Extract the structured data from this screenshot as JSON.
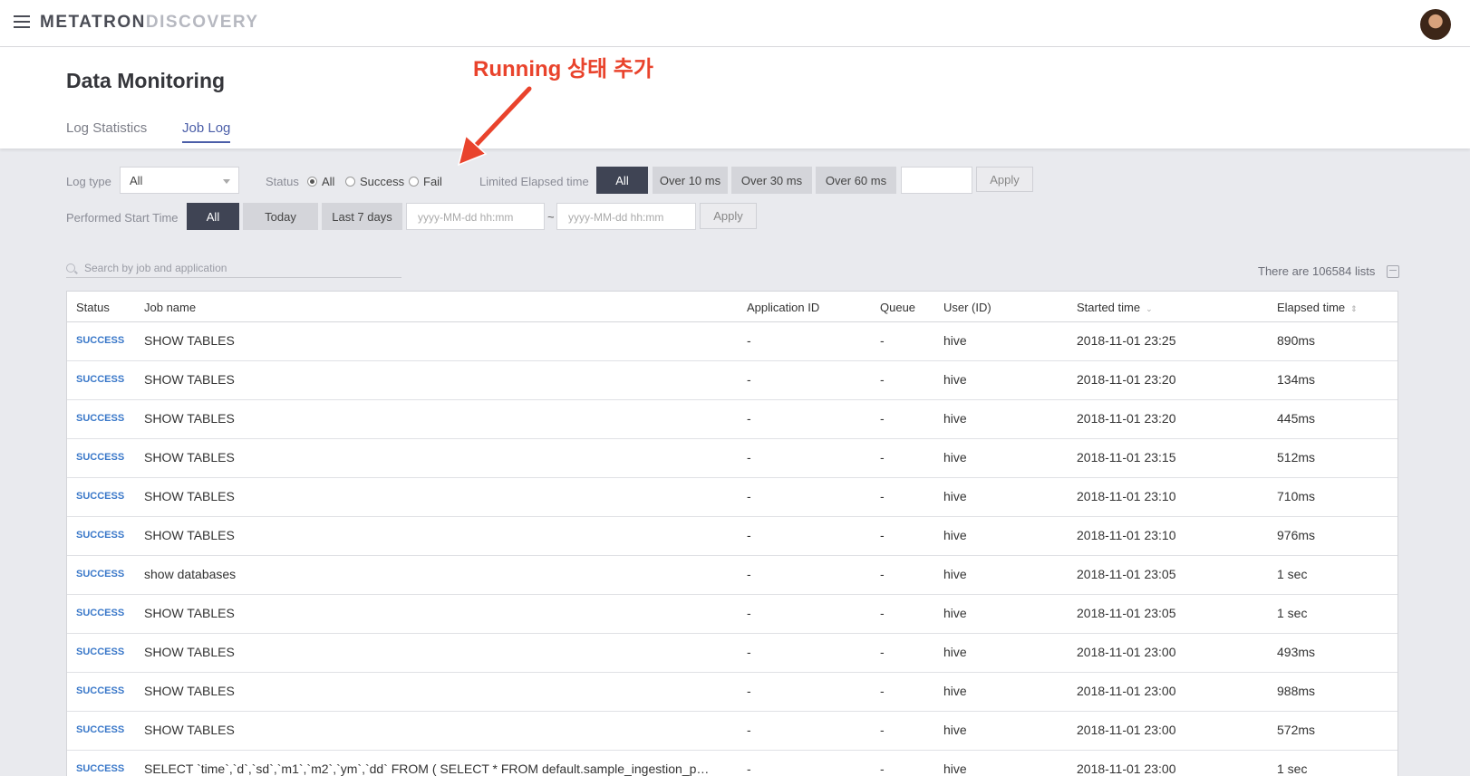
{
  "app": {
    "brand_part1": "METATRON",
    "brand_part2": "DISCOVERY"
  },
  "header": {
    "title": "Data Monitoring",
    "tabs": [
      {
        "label": "Log Statistics"
      },
      {
        "label": "Job Log"
      }
    ]
  },
  "annotation": {
    "text": "Running 상태 추가",
    "color": "#e9432c"
  },
  "filters": {
    "log_type_label": "Log type",
    "log_type_value": "All",
    "status_label": "Status",
    "status_options": [
      "All",
      "Success",
      "Fail"
    ],
    "status_selected": "All",
    "elapsed_label": "Limited Elapsed time",
    "elapsed_options": [
      "All",
      "Over 10 ms",
      "Over 30 ms",
      "Over 60 ms"
    ],
    "elapsed_apply": "Apply",
    "start_label": "Performed Start Time",
    "start_options": [
      "All",
      "Today",
      "Last 7 days"
    ],
    "date_placeholder": "yyyy-MM-dd hh:mm",
    "date_separator": "~",
    "start_apply": "Apply"
  },
  "search": {
    "placeholder": "Search by job and application"
  },
  "list_count_text": "There are 106584 lists",
  "table": {
    "columns": [
      "Status",
      "Job name",
      "Application ID",
      "Queue",
      "User (ID)",
      "Started time",
      "Elapsed time"
    ],
    "rows": [
      {
        "status": "SUCCESS",
        "job": "SHOW TABLES",
        "app": "-",
        "queue": "-",
        "user": "hive",
        "start": "2018-11-01 23:25",
        "elapsed": "890ms"
      },
      {
        "status": "SUCCESS",
        "job": "SHOW TABLES",
        "app": "-",
        "queue": "-",
        "user": "hive",
        "start": "2018-11-01 23:20",
        "elapsed": "134ms"
      },
      {
        "status": "SUCCESS",
        "job": "SHOW TABLES",
        "app": "-",
        "queue": "-",
        "user": "hive",
        "start": "2018-11-01 23:20",
        "elapsed": "445ms"
      },
      {
        "status": "SUCCESS",
        "job": "SHOW TABLES",
        "app": "-",
        "queue": "-",
        "user": "hive",
        "start": "2018-11-01 23:15",
        "elapsed": "512ms"
      },
      {
        "status": "SUCCESS",
        "job": "SHOW TABLES",
        "app": "-",
        "queue": "-",
        "user": "hive",
        "start": "2018-11-01 23:10",
        "elapsed": "710ms"
      },
      {
        "status": "SUCCESS",
        "job": "SHOW TABLES",
        "app": "-",
        "queue": "-",
        "user": "hive",
        "start": "2018-11-01 23:10",
        "elapsed": "976ms"
      },
      {
        "status": "SUCCESS",
        "job": "show databases",
        "app": "-",
        "queue": "-",
        "user": "hive",
        "start": "2018-11-01 23:05",
        "elapsed": "1 sec"
      },
      {
        "status": "SUCCESS",
        "job": "SHOW TABLES",
        "app": "-",
        "queue": "-",
        "user": "hive",
        "start": "2018-11-01 23:05",
        "elapsed": "1 sec"
      },
      {
        "status": "SUCCESS",
        "job": "SHOW TABLES",
        "app": "-",
        "queue": "-",
        "user": "hive",
        "start": "2018-11-01 23:00",
        "elapsed": "493ms"
      },
      {
        "status": "SUCCESS",
        "job": "SHOW TABLES",
        "app": "-",
        "queue": "-",
        "user": "hive",
        "start": "2018-11-01 23:00",
        "elapsed": "988ms"
      },
      {
        "status": "SUCCESS",
        "job": "SHOW TABLES",
        "app": "-",
        "queue": "-",
        "user": "hive",
        "start": "2018-11-01 23:00",
        "elapsed": "572ms"
      },
      {
        "status": "SUCCESS",
        "job": "SELECT `time`,`d`,`sd`,`m1`,`m2`,`ym`,`dd` FROM ( SELECT * FROM default.sample_ingestion_p…",
        "app": "-",
        "queue": "-",
        "user": "hive",
        "start": "2018-11-01 23:00",
        "elapsed": "1 sec"
      }
    ]
  }
}
